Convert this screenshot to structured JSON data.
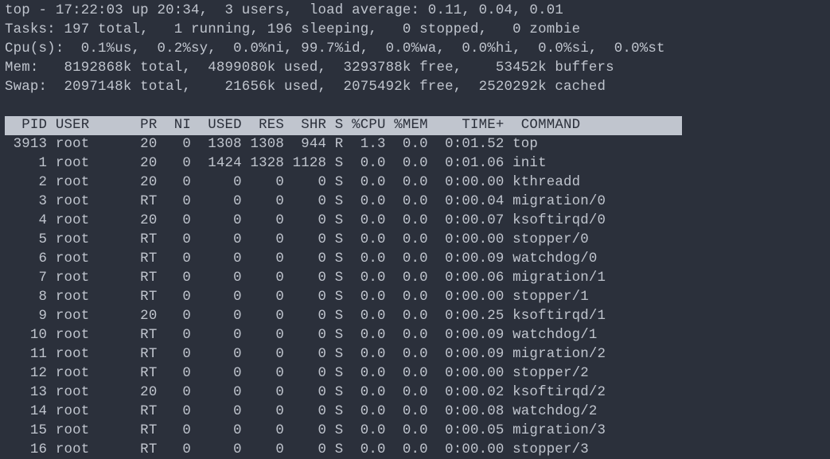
{
  "summary": {
    "line1": "top - 17:22:03 up 20:34,  3 users,  load average: 0.11, 0.04, 0.01",
    "line2": "Tasks: 197 total,   1 running, 196 sleeping,   0 stopped,   0 zombie",
    "line3": "Cpu(s):  0.1%us,  0.2%sy,  0.0%ni, 99.7%id,  0.0%wa,  0.0%hi,  0.0%si,  0.0%st",
    "line4": "Mem:   8192868k total,  4899080k used,  3293788k free,    53452k buffers",
    "line5": "Swap:  2097148k total,    21656k used,  2075492k free,  2520292k cached"
  },
  "columns_line": "  PID USER      PR  NI  USED  RES  SHR S %CPU %MEM    TIME+  COMMAND            ",
  "columns": [
    "PID",
    "USER",
    "PR",
    "NI",
    "USED",
    "RES",
    "SHR",
    "S",
    "%CPU",
    "%MEM",
    "TIME+",
    "COMMAND"
  ],
  "processes": [
    {
      "pid": "3913",
      "user": "root",
      "pr": "20",
      "ni": "0",
      "used": "1308",
      "res": "1308",
      "shr": "944",
      "s": "R",
      "cpu": "1.3",
      "mem": "0.0",
      "time": "0:01.52",
      "command": "top"
    },
    {
      "pid": "1",
      "user": "root",
      "pr": "20",
      "ni": "0",
      "used": "1424",
      "res": "1328",
      "shr": "1128",
      "s": "S",
      "cpu": "0.0",
      "mem": "0.0",
      "time": "0:01.06",
      "command": "init"
    },
    {
      "pid": "2",
      "user": "root",
      "pr": "20",
      "ni": "0",
      "used": "0",
      "res": "0",
      "shr": "0",
      "s": "S",
      "cpu": "0.0",
      "mem": "0.0",
      "time": "0:00.00",
      "command": "kthreadd"
    },
    {
      "pid": "3",
      "user": "root",
      "pr": "RT",
      "ni": "0",
      "used": "0",
      "res": "0",
      "shr": "0",
      "s": "S",
      "cpu": "0.0",
      "mem": "0.0",
      "time": "0:00.04",
      "command": "migration/0"
    },
    {
      "pid": "4",
      "user": "root",
      "pr": "20",
      "ni": "0",
      "used": "0",
      "res": "0",
      "shr": "0",
      "s": "S",
      "cpu": "0.0",
      "mem": "0.0",
      "time": "0:00.07",
      "command": "ksoftirqd/0"
    },
    {
      "pid": "5",
      "user": "root",
      "pr": "RT",
      "ni": "0",
      "used": "0",
      "res": "0",
      "shr": "0",
      "s": "S",
      "cpu": "0.0",
      "mem": "0.0",
      "time": "0:00.00",
      "command": "stopper/0"
    },
    {
      "pid": "6",
      "user": "root",
      "pr": "RT",
      "ni": "0",
      "used": "0",
      "res": "0",
      "shr": "0",
      "s": "S",
      "cpu": "0.0",
      "mem": "0.0",
      "time": "0:00.09",
      "command": "watchdog/0"
    },
    {
      "pid": "7",
      "user": "root",
      "pr": "RT",
      "ni": "0",
      "used": "0",
      "res": "0",
      "shr": "0",
      "s": "S",
      "cpu": "0.0",
      "mem": "0.0",
      "time": "0:00.06",
      "command": "migration/1"
    },
    {
      "pid": "8",
      "user": "root",
      "pr": "RT",
      "ni": "0",
      "used": "0",
      "res": "0",
      "shr": "0",
      "s": "S",
      "cpu": "0.0",
      "mem": "0.0",
      "time": "0:00.00",
      "command": "stopper/1"
    },
    {
      "pid": "9",
      "user": "root",
      "pr": "20",
      "ni": "0",
      "used": "0",
      "res": "0",
      "shr": "0",
      "s": "S",
      "cpu": "0.0",
      "mem": "0.0",
      "time": "0:00.25",
      "command": "ksoftirqd/1"
    },
    {
      "pid": "10",
      "user": "root",
      "pr": "RT",
      "ni": "0",
      "used": "0",
      "res": "0",
      "shr": "0",
      "s": "S",
      "cpu": "0.0",
      "mem": "0.0",
      "time": "0:00.09",
      "command": "watchdog/1"
    },
    {
      "pid": "11",
      "user": "root",
      "pr": "RT",
      "ni": "0",
      "used": "0",
      "res": "0",
      "shr": "0",
      "s": "S",
      "cpu": "0.0",
      "mem": "0.0",
      "time": "0:00.09",
      "command": "migration/2"
    },
    {
      "pid": "12",
      "user": "root",
      "pr": "RT",
      "ni": "0",
      "used": "0",
      "res": "0",
      "shr": "0",
      "s": "S",
      "cpu": "0.0",
      "mem": "0.0",
      "time": "0:00.00",
      "command": "stopper/2"
    },
    {
      "pid": "13",
      "user": "root",
      "pr": "20",
      "ni": "0",
      "used": "0",
      "res": "0",
      "shr": "0",
      "s": "S",
      "cpu": "0.0",
      "mem": "0.0",
      "time": "0:00.02",
      "command": "ksoftirqd/2"
    },
    {
      "pid": "14",
      "user": "root",
      "pr": "RT",
      "ni": "0",
      "used": "0",
      "res": "0",
      "shr": "0",
      "s": "S",
      "cpu": "0.0",
      "mem": "0.0",
      "time": "0:00.08",
      "command": "watchdog/2"
    },
    {
      "pid": "15",
      "user": "root",
      "pr": "RT",
      "ni": "0",
      "used": "0",
      "res": "0",
      "shr": "0",
      "s": "S",
      "cpu": "0.0",
      "mem": "0.0",
      "time": "0:00.05",
      "command": "migration/3"
    },
    {
      "pid": "16",
      "user": "root",
      "pr": "RT",
      "ni": "0",
      "used": "0",
      "res": "0",
      "shr": "0",
      "s": "S",
      "cpu": "0.0",
      "mem": "0.0",
      "time": "0:00.00",
      "command": "stopper/3"
    }
  ]
}
